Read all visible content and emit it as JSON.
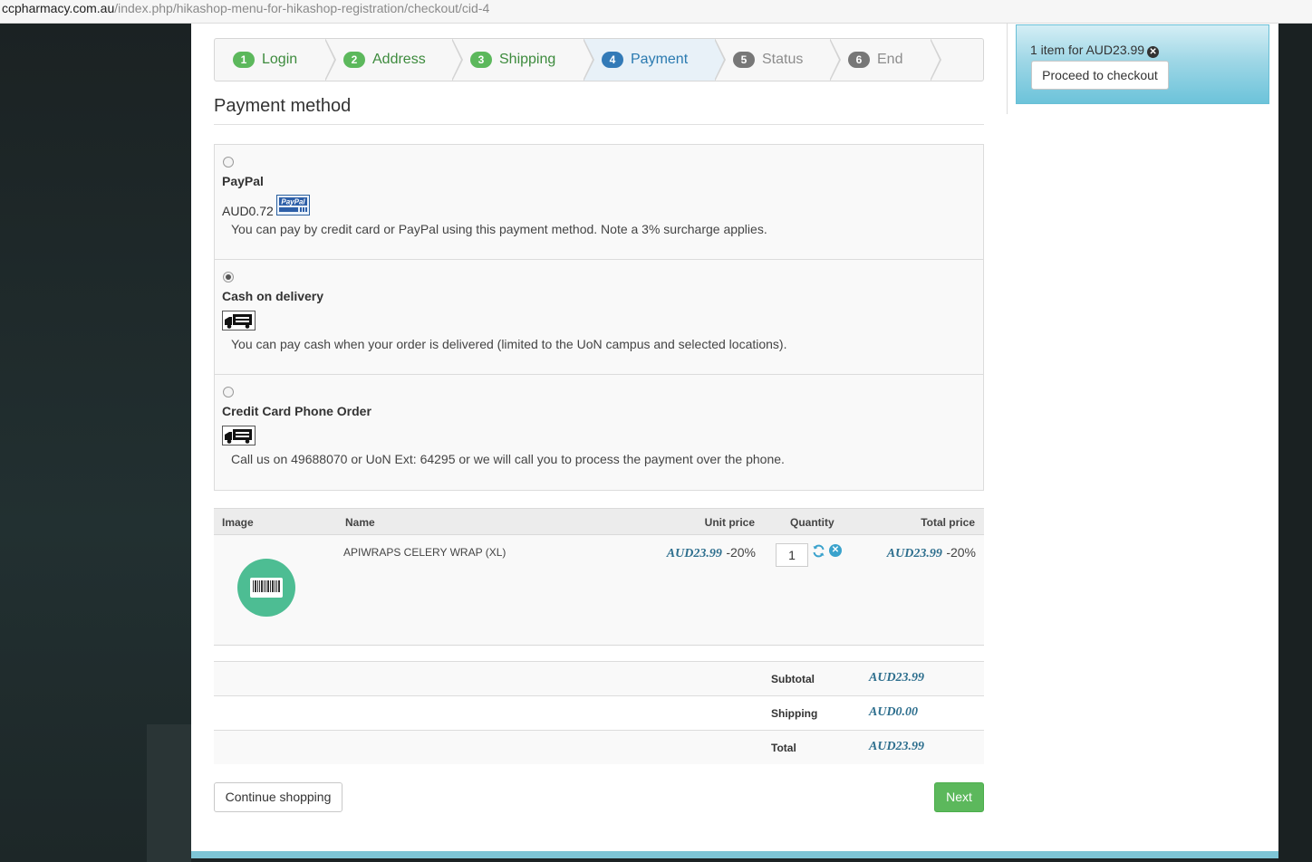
{
  "browser": {
    "url_host": "ccpharmacy.com.au",
    "url_path": "/index.php/hikashop-menu-for-hikashop-registration/checkout/cid-4"
  },
  "steps": [
    {
      "num": "1",
      "label": "Login",
      "state": "done"
    },
    {
      "num": "2",
      "label": "Address",
      "state": "done"
    },
    {
      "num": "3",
      "label": "Shipping",
      "state": "done"
    },
    {
      "num": "4",
      "label": "Payment",
      "state": "active"
    },
    {
      "num": "5",
      "label": "Status",
      "state": "todo"
    },
    {
      "num": "6",
      "label": "End",
      "state": "todo"
    }
  ],
  "section_title": "Payment method",
  "payment_methods": [
    {
      "name": "PayPal",
      "price": "AUD0.72",
      "logo": "paypal-logo-icon",
      "logo_text": "PayPal",
      "selected": false,
      "description": "You can pay by credit card or PayPal using this payment method. Note a 3% surcharge applies."
    },
    {
      "name": "Cash on delivery",
      "price": "",
      "logo": "delivery-truck-icon",
      "selected": true,
      "description": "You can pay cash when your order is delivered (limited to the UoN campus and selected locations)."
    },
    {
      "name": "Credit Card Phone Order",
      "price": "",
      "logo": "delivery-truck-icon",
      "selected": false,
      "description": "Call us on 49688070 or UoN Ext: 64295 or we will call you to process the payment over the phone."
    }
  ],
  "cart": {
    "headers": {
      "image": "Image",
      "name": "Name",
      "unit_price": "Unit price",
      "quantity": "Quantity",
      "total_price": "Total price"
    },
    "items": [
      {
        "name": "APIWRAPS CELERY WRAP (XL)",
        "unit_price": "AUD23.99",
        "unit_discount": "-20%",
        "quantity": "1",
        "total_price": "AUD23.99",
        "total_discount": "-20%",
        "image_icon": "barcode-icon"
      }
    ],
    "totals": [
      {
        "label": "Subtotal",
        "value": "AUD23.99"
      },
      {
        "label": "Shipping",
        "value": "AUD0.00"
      },
      {
        "label": "Total",
        "value": "AUD23.99"
      }
    ]
  },
  "buttons": {
    "continue": "Continue shopping",
    "next": "Next"
  },
  "minicart": {
    "info": "1 item for AUD23.99",
    "checkout": "Proceed to checkout"
  },
  "colors": {
    "accent": "#337ab7",
    "success": "#5cb85c",
    "price": "#2e6f8e",
    "minicart": "#9fd7e6"
  }
}
